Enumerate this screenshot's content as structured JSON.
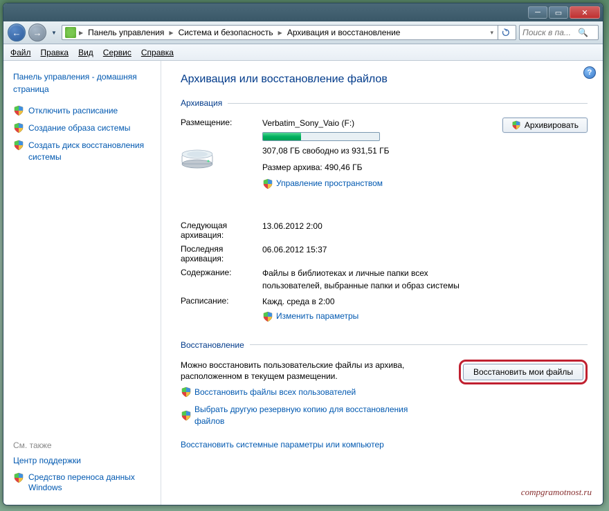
{
  "breadcrumb": {
    "items": [
      "Панель управления",
      "Система и безопасность",
      "Архивация и восстановление"
    ]
  },
  "search": {
    "placeholder": "Поиск в па..."
  },
  "menu": {
    "file": "Файл",
    "edit": "Правка",
    "view": "Вид",
    "tools": "Сервис",
    "help": "Справка"
  },
  "sidebar": {
    "home": "Панель управления - домашняя страница",
    "tasks": [
      "Отключить расписание",
      "Создание образа системы",
      "Создать диск восстановления системы"
    ],
    "also_head": "См. также",
    "also": [
      "Центр поддержки",
      "Средство переноса данных Windows"
    ]
  },
  "main": {
    "title": "Архивация или восстановление файлов",
    "archive_head": "Архивация",
    "location_label": "Размещение:",
    "location_value": "Verbatim_Sony_Vaio (F:)",
    "free_text": "307,08 ГБ свободно из 931,51 ГБ",
    "size_text": "Размер архива: 490,46 ГБ",
    "manage_link": "Управление пространством",
    "next_label": "Следующая архивация:",
    "next_value": "13.06.2012 2:00",
    "last_label": "Последняя архивация:",
    "last_value": "06.06.2012 15:37",
    "content_label": "Содержание:",
    "content_value": "Файлы в библиотеках и личные папки всех пользователей, выбранные папки и образ системы",
    "sched_label": "Расписание:",
    "sched_value": "Кажд. среда в 2:00",
    "change_link": "Изменить параметры",
    "archive_btn": "Архивировать",
    "restore_head": "Восстановление",
    "restore_desc": "Можно восстановить пользовательские файлы из архива, расположенном в текущем размещении.",
    "restore_btn": "Восстановить мои файлы",
    "restore_all_link": "Восстановить файлы всех пользователей",
    "restore_other_link": "Выбрать другую резервную копию для восстановления файлов",
    "restore_sys_link": "Восстановить системные параметры или компьютер"
  },
  "watermark": "compgramotnost.ru"
}
